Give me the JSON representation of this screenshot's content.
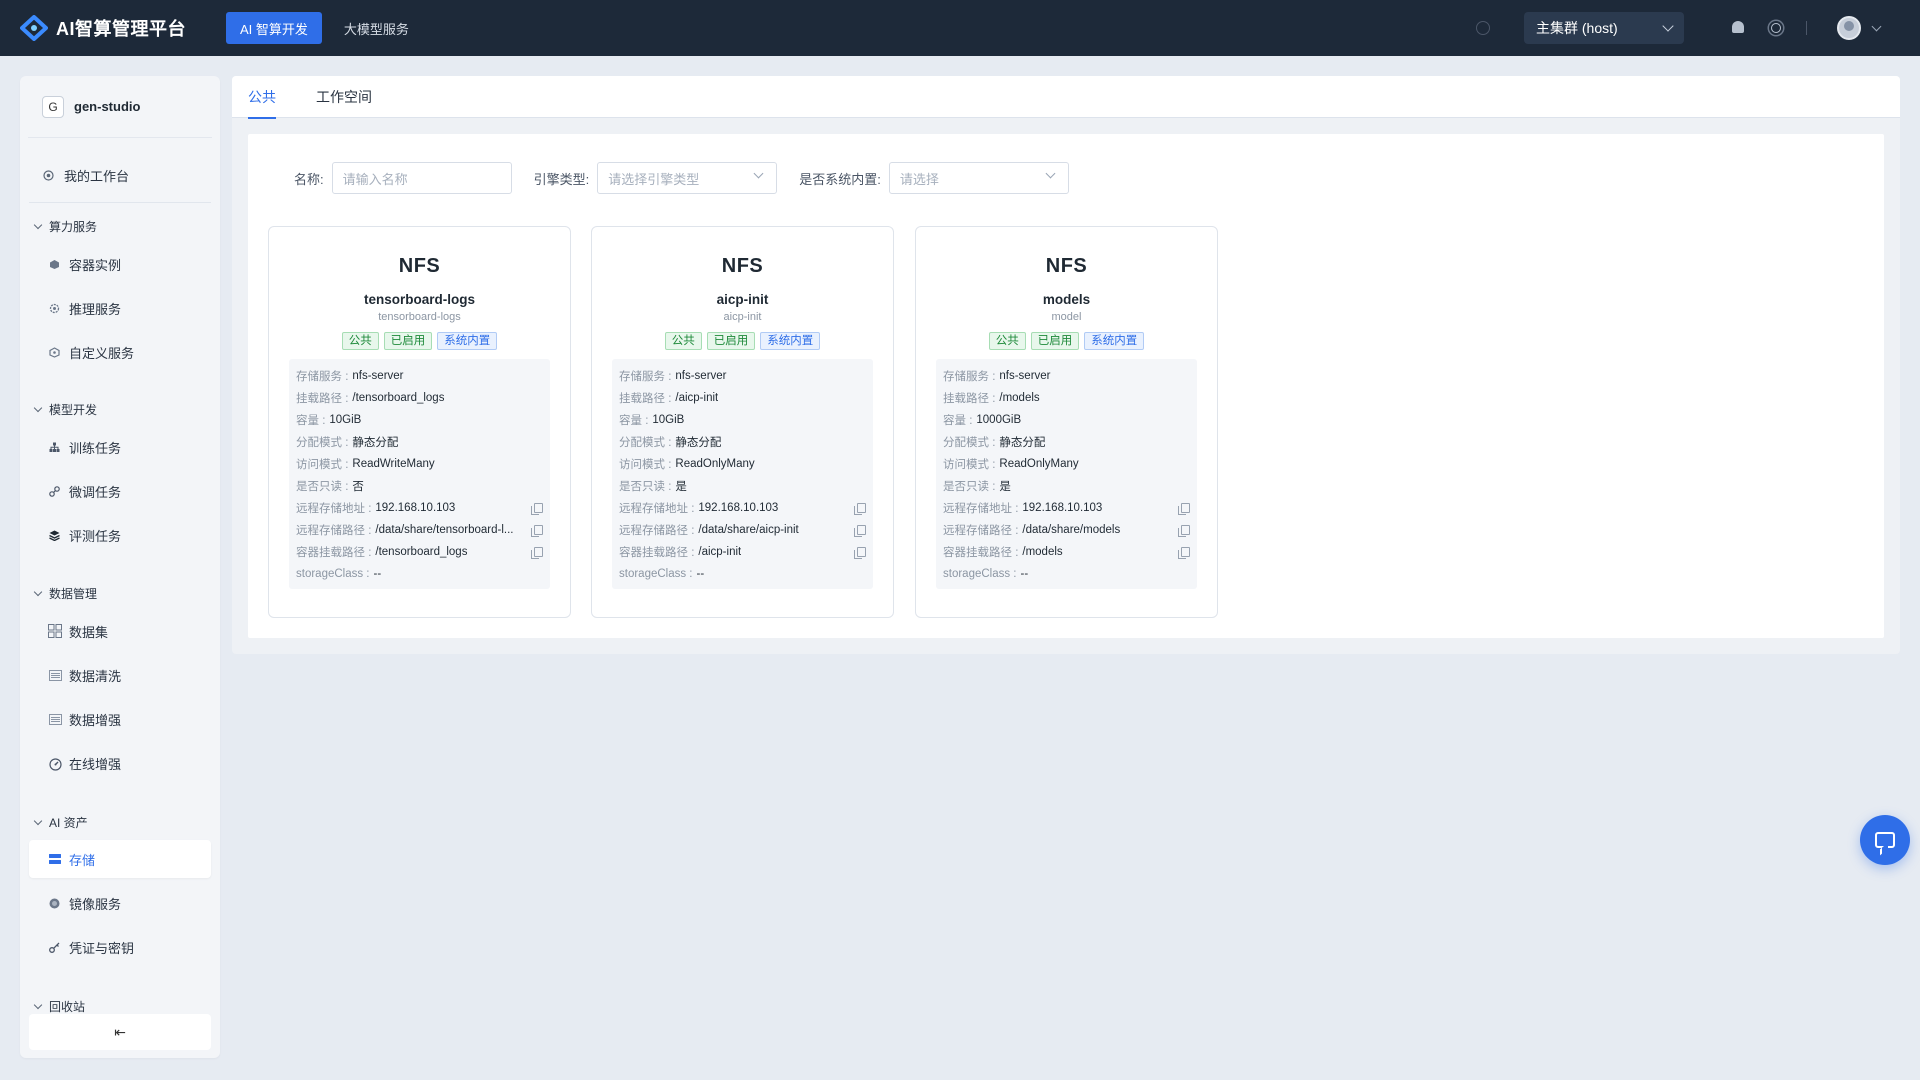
{
  "app": {
    "logo_text": "AI智算管理平台",
    "nav_tabs": [
      {
        "label": "AI 智算开发",
        "active": true
      },
      {
        "label": "大模型服务",
        "active": false
      }
    ],
    "cluster_selector": "主集群 (host)",
    "icons": [
      "search-icon",
      "bell-icon",
      "theme-icon",
      "avatar"
    ]
  },
  "sidebar": {
    "workspace_badge": "G",
    "workspace_name": "gen-studio",
    "workbench": "我的工作台",
    "groups": [
      {
        "label": "算力服务",
        "items": [
          "容器实例",
          "推理服务",
          "自定义服务"
        ]
      },
      {
        "label": "模型开发",
        "items": [
          "训练任务",
          "微调任务",
          "评测任务"
        ]
      },
      {
        "label": "数据管理",
        "items": [
          "数据集",
          "数据清洗",
          "数据增强",
          "在线增强"
        ]
      },
      {
        "label": "AI 资产",
        "items": [
          "存储",
          "镜像服务",
          "凭证与密钥"
        ]
      },
      {
        "label": "回收站",
        "items": []
      }
    ],
    "active_item": "存储",
    "collapse_icon": "⇤"
  },
  "tabs": [
    {
      "label": "公共",
      "active": true
    },
    {
      "label": "工作空间",
      "active": false
    }
  ],
  "filters": {
    "name_label": "名称:",
    "name_placeholder": "请输入名称",
    "engine_label": "引擎类型:",
    "engine_placeholder": "请选择引擎类型",
    "builtin_label": "是否系统内置:",
    "builtin_placeholder": "请选择"
  },
  "cards": [
    {
      "type": "NFS",
      "title": "tensorboard-logs",
      "subtitle": "tensorboard-logs",
      "tags": [
        "公共",
        "已启用",
        "系统内置"
      ],
      "rows": [
        {
          "k": "存储服务 :",
          "v": "nfs-server"
        },
        {
          "k": "挂载路径 :",
          "v": "/tensorboard_logs"
        },
        {
          "k": "容量 :",
          "v": "10GiB"
        },
        {
          "k": "分配模式 :",
          "v": "静态分配"
        },
        {
          "k": "访问模式 :",
          "v": "ReadWriteMany"
        },
        {
          "k": "是否只读 :",
          "v": "否"
        },
        {
          "k": "远程存储地址 :",
          "v": "192.168.10.103"
        },
        {
          "k": "远程存储路径 :",
          "v": "/data/share/tensorboard-l..."
        },
        {
          "k": "容器挂载路径 :",
          "v": "/tensorboard_logs"
        },
        {
          "k": "storageClass :",
          "v": "--"
        }
      ]
    },
    {
      "type": "NFS",
      "title": "aicp-init",
      "subtitle": "aicp-init",
      "tags": [
        "公共",
        "已启用",
        "系统内置"
      ],
      "rows": [
        {
          "k": "存储服务 :",
          "v": "nfs-server"
        },
        {
          "k": "挂载路径 :",
          "v": "/aicp-init"
        },
        {
          "k": "容量 :",
          "v": "10GiB"
        },
        {
          "k": "分配模式 :",
          "v": "静态分配"
        },
        {
          "k": "访问模式 :",
          "v": "ReadOnlyMany"
        },
        {
          "k": "是否只读 :",
          "v": "是"
        },
        {
          "k": "远程存储地址 :",
          "v": "192.168.10.103"
        },
        {
          "k": "远程存储路径 :",
          "v": "/data/share/aicp-init"
        },
        {
          "k": "容器挂载路径 :",
          "v": "/aicp-init"
        },
        {
          "k": "storageClass :",
          "v": "--"
        }
      ]
    },
    {
      "type": "NFS",
      "title": "models",
      "subtitle": "model",
      "tags": [
        "公共",
        "已启用",
        "系统内置"
      ],
      "rows": [
        {
          "k": "存储服务 :",
          "v": "nfs-server"
        },
        {
          "k": "挂载路径 :",
          "v": "/models"
        },
        {
          "k": "容量 :",
          "v": "1000GiB"
        },
        {
          "k": "分配模式 :",
          "v": "静态分配"
        },
        {
          "k": "访问模式 :",
          "v": "ReadOnlyMany"
        },
        {
          "k": "是否只读 :",
          "v": "是"
        },
        {
          "k": "远程存储地址 :",
          "v": "192.168.10.103"
        },
        {
          "k": "远程存储路径 :",
          "v": "/data/share/models"
        },
        {
          "k": "容器挂载路径 :",
          "v": "/models"
        },
        {
          "k": "storageClass :",
          "v": "--"
        }
      ]
    }
  ],
  "colors": {
    "accent": "#2f6ee8",
    "topbar": "#1d2939",
    "tag_green": "#1e8a3a",
    "tag_blue": "#2f6ee8"
  }
}
